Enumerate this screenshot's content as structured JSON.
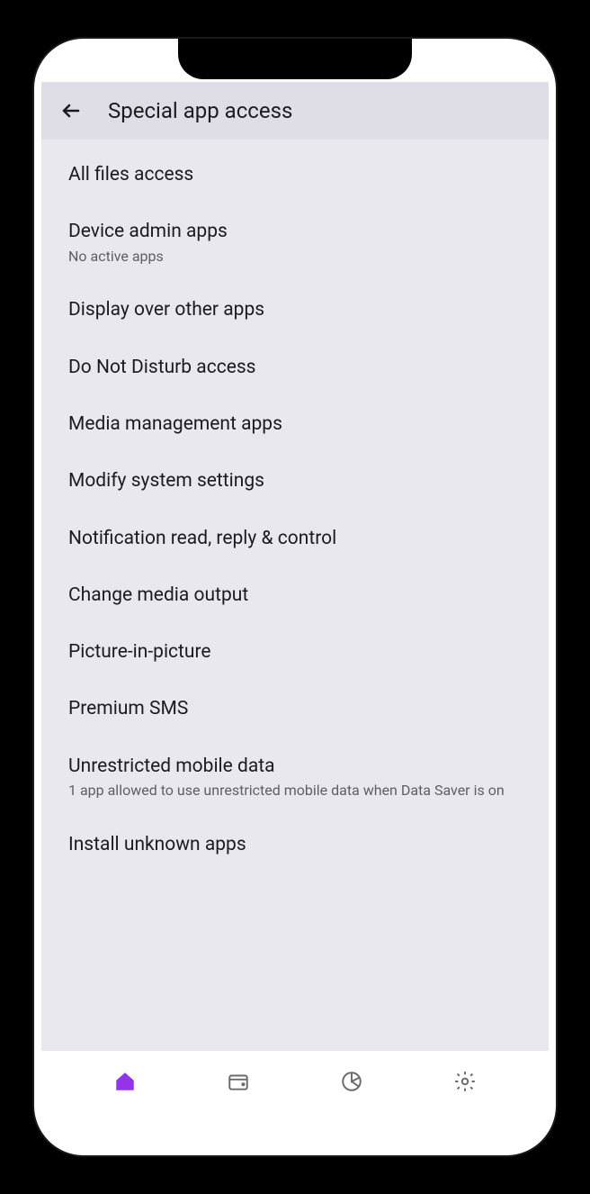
{
  "header": {
    "title": "Special app access"
  },
  "items": [
    {
      "title": "All files access",
      "subtitle": null
    },
    {
      "title": "Device admin apps",
      "subtitle": "No active apps"
    },
    {
      "title": "Display over other apps",
      "subtitle": null
    },
    {
      "title": "Do Not Disturb access",
      "subtitle": null
    },
    {
      "title": "Media management apps",
      "subtitle": null
    },
    {
      "title": "Modify system settings",
      "subtitle": null
    },
    {
      "title": "Notification read, reply & control",
      "subtitle": null
    },
    {
      "title": "Change media output",
      "subtitle": null
    },
    {
      "title": "Picture-in-picture",
      "subtitle": null
    },
    {
      "title": "Premium SMS",
      "subtitle": null
    },
    {
      "title": "Unrestricted mobile data",
      "subtitle": "1 app allowed to use unrestricted mobile data when Data Saver is on"
    },
    {
      "title": "Install unknown apps",
      "subtitle": null
    }
  ],
  "nav": {
    "home": "home-icon",
    "wallet": "wallet-icon",
    "chart": "pie-chart-icon",
    "settings": "gear-icon"
  },
  "colors": {
    "accent": "#9333ea",
    "background": "#e9e8ee",
    "headerBg": "#dfdee6",
    "text": "#1c1b1f",
    "subtext": "#5f5e66"
  }
}
